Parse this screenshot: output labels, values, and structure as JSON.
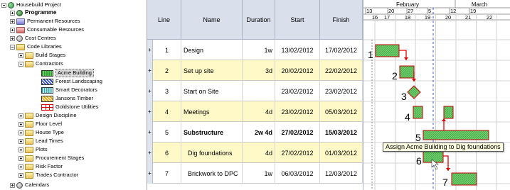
{
  "tree": {
    "items": [
      {
        "label": "Housebuild Project",
        "bold": false
      },
      {
        "label": "Programme",
        "bold": true
      },
      {
        "label": "Permanent Resources",
        "bold": false
      },
      {
        "label": "Consumable Resources",
        "bold": false
      },
      {
        "label": "Cost Centres",
        "bold": false
      },
      {
        "label": "Code Libraries",
        "bold": false
      },
      {
        "label": "Build Stages",
        "bold": false
      },
      {
        "label": "Contractors",
        "bold": false
      },
      {
        "label": "Acme Building",
        "bold": false
      },
      {
        "label": "Forest Landscaping",
        "bold": false
      },
      {
        "label": "Smart Decorators",
        "bold": false
      },
      {
        "label": "Jansons Timber",
        "bold": false
      },
      {
        "label": "Goldstone Utilities",
        "bold": false
      },
      {
        "label": "Design Discipline",
        "bold": false
      },
      {
        "label": "Floor Level",
        "bold": false
      },
      {
        "label": "House Type",
        "bold": false
      },
      {
        "label": "Lead Times",
        "bold": false
      },
      {
        "label": "Plots",
        "bold": false
      },
      {
        "label": "Procurement Stages",
        "bold": false
      },
      {
        "label": "Risk Factor",
        "bold": false
      },
      {
        "label": "Trades Contractor",
        "bold": false
      },
      {
        "label": "Calendars",
        "bold": false
      }
    ]
  },
  "grid": {
    "headers": {
      "line": "Line",
      "name": "Name",
      "duration": "Duration",
      "start": "Start",
      "finish": "Finish"
    },
    "rows": [
      {
        "line": "1",
        "name": "Design",
        "duration": "1w",
        "start": "13/02/2012",
        "finish": "17/02/2012",
        "yellow": false,
        "bold": false,
        "indent": false
      },
      {
        "line": "2",
        "name": "Set up site",
        "duration": "3d",
        "start": "20/02/2012",
        "finish": "22/02/2012",
        "yellow": true,
        "bold": false,
        "indent": false
      },
      {
        "line": "3",
        "name": "Start on Site",
        "duration": "",
        "start": "23/02/2012",
        "finish": "23/02/2012",
        "yellow": false,
        "bold": false,
        "indent": false
      },
      {
        "line": "4",
        "name": "Meetings",
        "duration": "4d",
        "start": "23/02/2012",
        "finish": "05/03/2012",
        "yellow": true,
        "bold": false,
        "indent": false
      },
      {
        "line": "5",
        "name": "Substructure",
        "duration": "2w 4d",
        "start": "27/02/2012",
        "finish": "15/03/2012",
        "yellow": false,
        "bold": true,
        "indent": false
      },
      {
        "line": "6",
        "name": "Dig foundations",
        "duration": "4d",
        "start": "27/02/2012",
        "finish": "01/03/2012",
        "yellow": true,
        "bold": false,
        "indent": true
      },
      {
        "line": "7",
        "name": "Brickwork to DPC",
        "duration": "1w",
        "start": "06/03/2012",
        "finish": "12/03/2012",
        "yellow": false,
        "bold": false,
        "indent": true
      }
    ],
    "row_marker": "+"
  },
  "gantt": {
    "months": [
      "February",
      "March"
    ],
    "weeks": [
      "13",
      "20",
      "27",
      "5",
      "12",
      "19"
    ],
    "days": [
      "16",
      "17",
      "18",
      "19",
      "20",
      "21",
      "22"
    ],
    "labels": [
      "1",
      "2",
      "3",
      "4",
      "5",
      "6",
      "7"
    ],
    "bar_color": "#6fcf6f",
    "bar_border": "#c00000",
    "arrow_color": "#e00000"
  },
  "tooltip": "Assign Acme Building to Dig foundations"
}
